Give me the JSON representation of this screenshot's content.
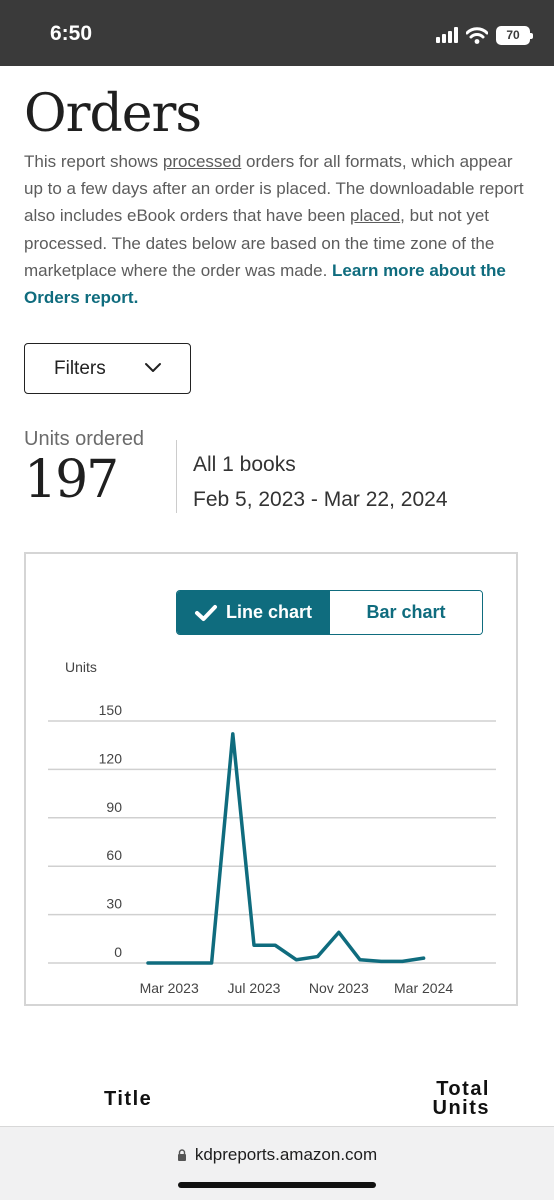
{
  "status_bar": {
    "time": "6:50",
    "battery": "70",
    "icons": [
      "signal-icon",
      "wifi-icon",
      "battery-icon"
    ]
  },
  "page": {
    "title": "Orders",
    "intro": {
      "p1": "This report shows ",
      "processed": "processed",
      "p2": " orders for all formats, which appear up to a few days after an order is placed. The downloadable report also includes eBook orders that have been ",
      "placed": "placed",
      "p3": ", but not yet processed. The dates below are based on the time zone of the marketplace where the order was made.  ",
      "learn_more": "Learn more about the Orders report."
    }
  },
  "filters": {
    "label": "Filters",
    "icon": "chevron-down-icon"
  },
  "summary": {
    "units_label": "Units ordered",
    "units_value": "197",
    "books": "All 1 books",
    "date_range": "Feb 5, 2023 - Mar 22, 2024"
  },
  "chart_toggle": {
    "line_label": "Line chart",
    "bar_label": "Bar chart",
    "selected": "line",
    "check_icon": "checkmark-icon"
  },
  "chart_data": {
    "type": "line",
    "ylabel": "Units",
    "ylim": [
      0,
      150
    ],
    "yticks": [
      150,
      120,
      90,
      60,
      30,
      0
    ],
    "xticks": [
      "Mar 2023",
      "Jul 2023",
      "Nov 2023",
      "Mar 2024"
    ],
    "grid": true,
    "color": "#0f6c7e",
    "x": [
      "2023-02",
      "2023-03",
      "2023-04",
      "2023-05",
      "2023-06",
      "2023-07",
      "2023-08",
      "2023-09",
      "2023-10",
      "2023-11",
      "2023-12",
      "2024-01",
      "2024-02",
      "2024-03"
    ],
    "values": [
      0,
      0,
      0,
      0,
      142,
      11,
      11,
      2,
      4,
      19,
      2,
      1,
      1,
      3
    ]
  },
  "table_header": {
    "title_col": "Title",
    "total_line1": "Total",
    "total_line2": "Units"
  },
  "browser": {
    "url": "kdpreports.amazon.com",
    "lock_icon": "lock-icon"
  },
  "colors": {
    "accent": "#0f6c7e",
    "status_bar": "#3a3a3a"
  }
}
